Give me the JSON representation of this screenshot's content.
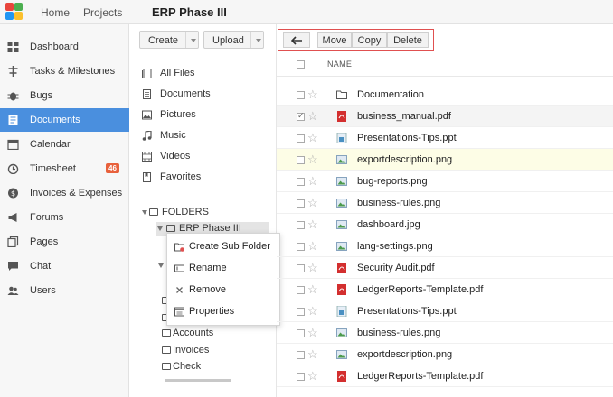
{
  "topbar": {
    "home": "Home",
    "projects": "Projects",
    "project_title": "ERP Phase III"
  },
  "sidebar": {
    "items": [
      {
        "label": "Dashboard",
        "icon": "dashboard-icon"
      },
      {
        "label": "Tasks & Milestones",
        "icon": "tasks-icon"
      },
      {
        "label": "Bugs",
        "icon": "bug-icon"
      },
      {
        "label": "Documents",
        "icon": "documents-icon",
        "active": true
      },
      {
        "label": "Calendar",
        "icon": "calendar-icon"
      },
      {
        "label": "Timesheet",
        "icon": "clock-icon",
        "badge": "46"
      },
      {
        "label": "Invoices & Expenses",
        "icon": "invoice-icon"
      },
      {
        "label": "Forums",
        "icon": "megaphone-icon"
      },
      {
        "label": "Pages",
        "icon": "pages-icon"
      },
      {
        "label": "Chat",
        "icon": "chat-icon"
      },
      {
        "label": "Users",
        "icon": "users-icon"
      }
    ]
  },
  "leftpane": {
    "create_label": "Create",
    "upload_label": "Upload",
    "library": [
      {
        "label": "All Files",
        "icon": "files-icon"
      },
      {
        "label": "Documents",
        "icon": "document-icon"
      },
      {
        "label": "Pictures",
        "icon": "picture-icon"
      },
      {
        "label": "Music",
        "icon": "music-icon"
      },
      {
        "label": "Videos",
        "icon": "video-icon"
      },
      {
        "label": "Favorites",
        "icon": "favorites-icon"
      }
    ],
    "folders_label": "FOLDERS",
    "current_folder": "ERP Phase III",
    "subfolders": [
      "Accounts",
      "Invoices",
      "Check"
    ]
  },
  "context_menu": {
    "items": [
      {
        "label": "Create Sub Folder",
        "icon": "new-folder-icon"
      },
      {
        "label": "Rename",
        "icon": "rename-icon"
      },
      {
        "label": "Remove",
        "icon": "remove-icon"
      },
      {
        "label": "Properties",
        "icon": "properties-icon"
      }
    ]
  },
  "toolbar": {
    "back_icon": "back-arrow-icon",
    "move_label": "Move",
    "copy_label": "Copy",
    "delete_label": "Delete"
  },
  "file_list": {
    "column_name": "NAME",
    "files": [
      {
        "name": "Documentation",
        "type": "folder"
      },
      {
        "name": "business_manual.pdf",
        "type": "pdf",
        "checked": true
      },
      {
        "name": "Presentations-Tips.ppt",
        "type": "ppt"
      },
      {
        "name": "exportdescription.png",
        "type": "image",
        "highlighted": true
      },
      {
        "name": "bug-reports.png",
        "type": "image"
      },
      {
        "name": "business-rules.png",
        "type": "image"
      },
      {
        "name": "dashboard.jpg",
        "type": "image"
      },
      {
        "name": "lang-settings.png",
        "type": "image"
      },
      {
        "name": "Security Audit.pdf",
        "type": "pdf"
      },
      {
        "name": "LedgerReports-Template.pdf",
        "type": "pdf"
      },
      {
        "name": "Presentations-Tips.ppt",
        "type": "ppt"
      },
      {
        "name": "business-rules.png",
        "type": "image"
      },
      {
        "name": "exportdescription.png",
        "type": "image"
      },
      {
        "name": "LedgerReports-Template.pdf",
        "type": "pdf"
      }
    ]
  },
  "colors": {
    "accent": "#4a8fde",
    "badge": "#e8613c",
    "highlight_row": "#fdfde6",
    "toolbar_outline": "#e05050",
    "pdf": "#d32f2f"
  }
}
